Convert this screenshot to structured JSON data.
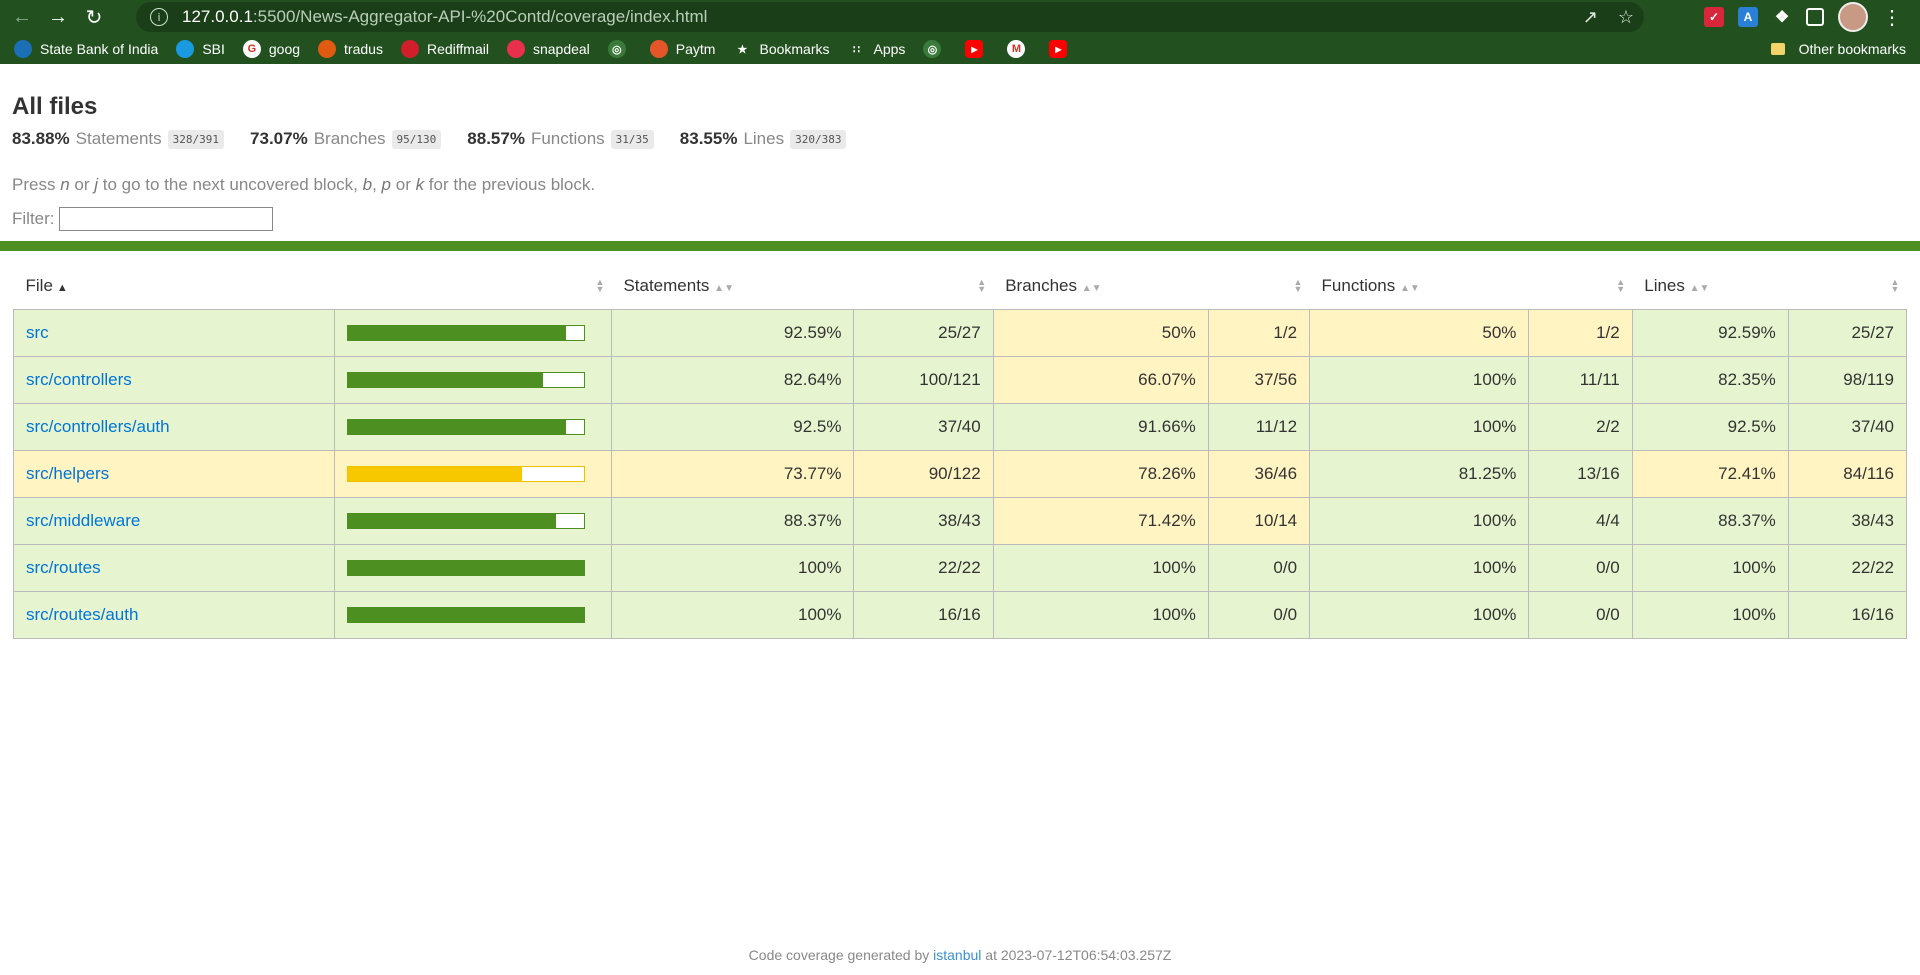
{
  "browser": {
    "url_host": "127.0.0.1",
    "url_rest": ":5500/News-Aggregator-API-%20Contd/coverage/index.html",
    "bookmarks": [
      {
        "label": "State Bank of India",
        "color": "#1a6fb5",
        "icon": "sbi-icon"
      },
      {
        "label": "SBI",
        "color": "#1a9be0",
        "icon": "sbi-icon"
      },
      {
        "label": "goog",
        "color": "#ffffff",
        "icon": "google-icon"
      },
      {
        "label": "tradus",
        "color": "#e05a10",
        "icon": "tradus-icon"
      },
      {
        "label": "Rediffmail",
        "color": "#d01f2a",
        "icon": "rediff-icon"
      },
      {
        "label": "snapdeal",
        "color": "#e8304d",
        "icon": "snapdeal-icon"
      },
      {
        "label": "",
        "color": "#3a7a3a",
        "icon": "globe-icon"
      },
      {
        "label": "Paytm",
        "color": "#e4562a",
        "icon": "paytm-icon"
      },
      {
        "label": "Bookmarks",
        "color": "#22511f",
        "icon": "star-icon"
      },
      {
        "label": "Apps",
        "color": "#22511f",
        "icon": "apps-grid-icon"
      },
      {
        "label": "",
        "color": "#3a7a3a",
        "icon": "globe-icon"
      },
      {
        "label": "",
        "color": "#ff0000",
        "icon": "youtube-icon"
      },
      {
        "label": "",
        "color": "#ffffff",
        "icon": "gmail-icon"
      },
      {
        "label": "",
        "color": "#ff0000",
        "icon": "youtube-icon"
      }
    ],
    "other_bookmarks": "Other bookmarks"
  },
  "page": {
    "title": "All files",
    "summary": [
      {
        "pct": "83.88%",
        "label": "Statements",
        "frac": "328/391"
      },
      {
        "pct": "73.07%",
        "label": "Branches",
        "frac": "95/130"
      },
      {
        "pct": "88.57%",
        "label": "Functions",
        "frac": "31/35"
      },
      {
        "pct": "83.55%",
        "label": "Lines",
        "frac": "320/383"
      }
    ],
    "hint": {
      "p1": "Press ",
      "k1": "n",
      "p2": " or ",
      "k2": "j",
      "p3": " to go to the next uncovered block, ",
      "k3": "b",
      "p4": ", ",
      "k4": "p",
      "p5": " or ",
      "k5": "k",
      "p6": " for the previous block."
    },
    "filter_label": "Filter:",
    "columns": {
      "file": "File",
      "statements": "Statements",
      "branches": "Branches",
      "functions": "Functions",
      "lines": "Lines"
    },
    "rows": [
      {
        "file": "src",
        "level": "high",
        "bar": 0.9259,
        "st_pct": "92.59%",
        "st": "25/27",
        "st_lvl": "high",
        "br_pct": "50%",
        "br": "1/2",
        "br_lvl": "medium",
        "fn_pct": "50%",
        "fn": "1/2",
        "fn_lvl": "medium",
        "ln_pct": "92.59%",
        "ln": "25/27",
        "ln_lvl": "high"
      },
      {
        "file": "src/controllers",
        "level": "high",
        "bar": 0.8264,
        "st_pct": "82.64%",
        "st": "100/121",
        "st_lvl": "high",
        "br_pct": "66.07%",
        "br": "37/56",
        "br_lvl": "medium",
        "fn_pct": "100%",
        "fn": "11/11",
        "fn_lvl": "high",
        "ln_pct": "82.35%",
        "ln": "98/119",
        "ln_lvl": "high"
      },
      {
        "file": "src/controllers/auth",
        "level": "high",
        "bar": 0.925,
        "st_pct": "92.5%",
        "st": "37/40",
        "st_lvl": "high",
        "br_pct": "91.66%",
        "br": "11/12",
        "br_lvl": "high",
        "fn_pct": "100%",
        "fn": "2/2",
        "fn_lvl": "high",
        "ln_pct": "92.5%",
        "ln": "37/40",
        "ln_lvl": "high"
      },
      {
        "file": "src/helpers",
        "level": "medium",
        "bar": 0.7377,
        "st_pct": "73.77%",
        "st": "90/122",
        "st_lvl": "medium",
        "br_pct": "78.26%",
        "br": "36/46",
        "br_lvl": "medium",
        "fn_pct": "81.25%",
        "fn": "13/16",
        "fn_lvl": "high",
        "ln_pct": "72.41%",
        "ln": "84/116",
        "ln_lvl": "medium"
      },
      {
        "file": "src/middleware",
        "level": "high",
        "bar": 0.8837,
        "st_pct": "88.37%",
        "st": "38/43",
        "st_lvl": "high",
        "br_pct": "71.42%",
        "br": "10/14",
        "br_lvl": "medium",
        "fn_pct": "100%",
        "fn": "4/4",
        "fn_lvl": "high",
        "ln_pct": "88.37%",
        "ln": "38/43",
        "ln_lvl": "high"
      },
      {
        "file": "src/routes",
        "level": "high",
        "bar": 1.0,
        "st_pct": "100%",
        "st": "22/22",
        "st_lvl": "high",
        "br_pct": "100%",
        "br": "0/0",
        "br_lvl": "high",
        "fn_pct": "100%",
        "fn": "0/0",
        "fn_lvl": "high",
        "ln_pct": "100%",
        "ln": "22/22",
        "ln_lvl": "high"
      },
      {
        "file": "src/routes/auth",
        "level": "high",
        "bar": 1.0,
        "st_pct": "100%",
        "st": "16/16",
        "st_lvl": "high",
        "br_pct": "100%",
        "br": "0/0",
        "br_lvl": "high",
        "fn_pct": "100%",
        "fn": "0/0",
        "fn_lvl": "high",
        "ln_pct": "100%",
        "ln": "16/16",
        "ln_lvl": "high"
      }
    ],
    "footer": {
      "prefix": "Code coverage generated by ",
      "link": "istanbul",
      "suffix": " at 2023-07-12T06:54:03.257Z"
    },
    "colors": {
      "high": "#e6f5d0",
      "medium": "#fff4c2",
      "bar_high": "#4d8f20",
      "bar_medium": "#f7c800"
    }
  }
}
